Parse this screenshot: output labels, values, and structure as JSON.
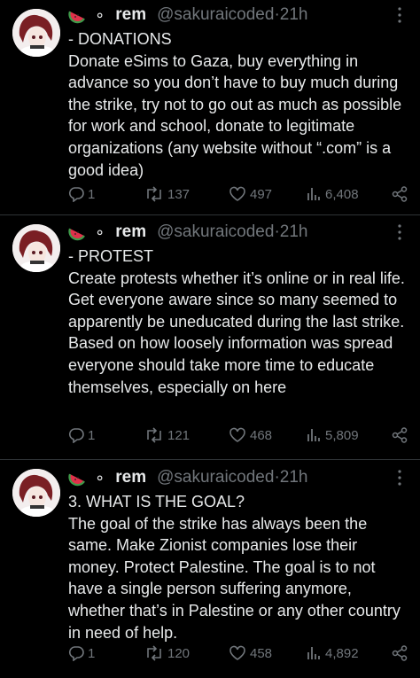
{
  "tweets": [
    {
      "name": "rem",
      "handle": "@sakuraicoded",
      "separator": "·",
      "time": "21h",
      "text": "- DONATIONS\nDonate eSims to Gaza, buy everything in advance so you don’t have to buy much during the strike, try not to go out as much as possible for work and school, donate to legitimate organizations (any website without “.com” is a good idea)",
      "replies": "1",
      "reposts": "137",
      "likes": "497",
      "views": "6,408"
    },
    {
      "name": "rem",
      "handle": "@sakuraicoded",
      "separator": "·",
      "time": "21h",
      "text": "- PROTEST\nCreate protests whether it’s online or in real life. Get everyone aware since so many seemed to apparently be uneducated during the last strike. Based on how loosely information was spread everyone should take more time to educate themselves, especially on here",
      "replies": "1",
      "reposts": "121",
      "likes": "468",
      "views": "5,809"
    },
    {
      "name": "rem",
      "handle": "@sakuraicoded",
      "separator": "·",
      "time": "21h",
      "text": "3. WHAT IS THE GOAL?\nThe goal of the strike has always been the same. Make Zionist companies lose their money. Protect Palestine. The goal is to not have a single person suffering anymore, whether that’s in Palestine or any other country in need of help.",
      "replies": "1",
      "reposts": "120",
      "likes": "458",
      "views": "4,892"
    }
  ],
  "icons": {
    "display_name_emoji": "watermelon-icon",
    "display_name_bullet": "∘",
    "more": "more-icon",
    "reply": "reply-icon",
    "repost": "repost-icon",
    "like": "heart-icon",
    "views": "views-icon",
    "share": "share-icon"
  },
  "colors": {
    "background": "#000000",
    "text": "#e7e9ea",
    "muted": "#71767b",
    "divider": "#2f3336"
  }
}
